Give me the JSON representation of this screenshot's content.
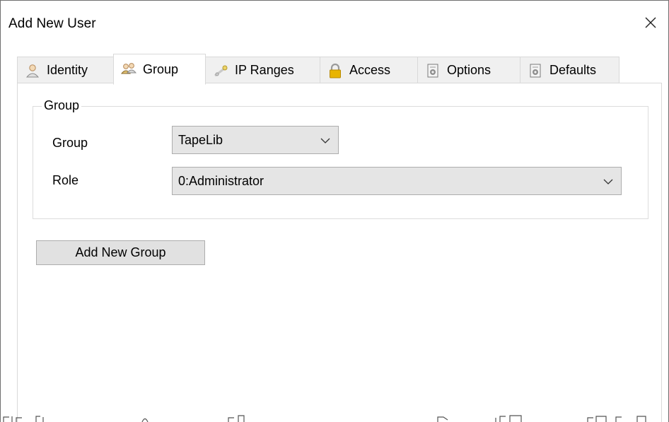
{
  "window": {
    "title": "Add New User",
    "close_symbol": "×"
  },
  "tabs": [
    {
      "label": "Identity",
      "icon": "user-icon",
      "active": false
    },
    {
      "label": "Group",
      "icon": "users-icon",
      "active": true
    },
    {
      "label": "IP Ranges",
      "icon": "network-icon",
      "active": false
    },
    {
      "label": "Access",
      "icon": "lock-icon",
      "active": false
    },
    {
      "label": "Options",
      "icon": "settings-doc-icon",
      "active": false
    },
    {
      "label": "Defaults",
      "icon": "settings-doc-icon",
      "active": false
    }
  ],
  "group_box": {
    "legend": "Group",
    "group_label": "Group",
    "group_value": "TapeLib",
    "role_label": "Role",
    "role_value": "0:Administrator"
  },
  "actions": {
    "add_group_label": "Add New Group"
  },
  "colors": {
    "accent_lock": "#e8b400",
    "tab_bg": "#f0f0f0",
    "combo_bg": "#e5e5e5",
    "button_bg": "#e1e1e1"
  }
}
